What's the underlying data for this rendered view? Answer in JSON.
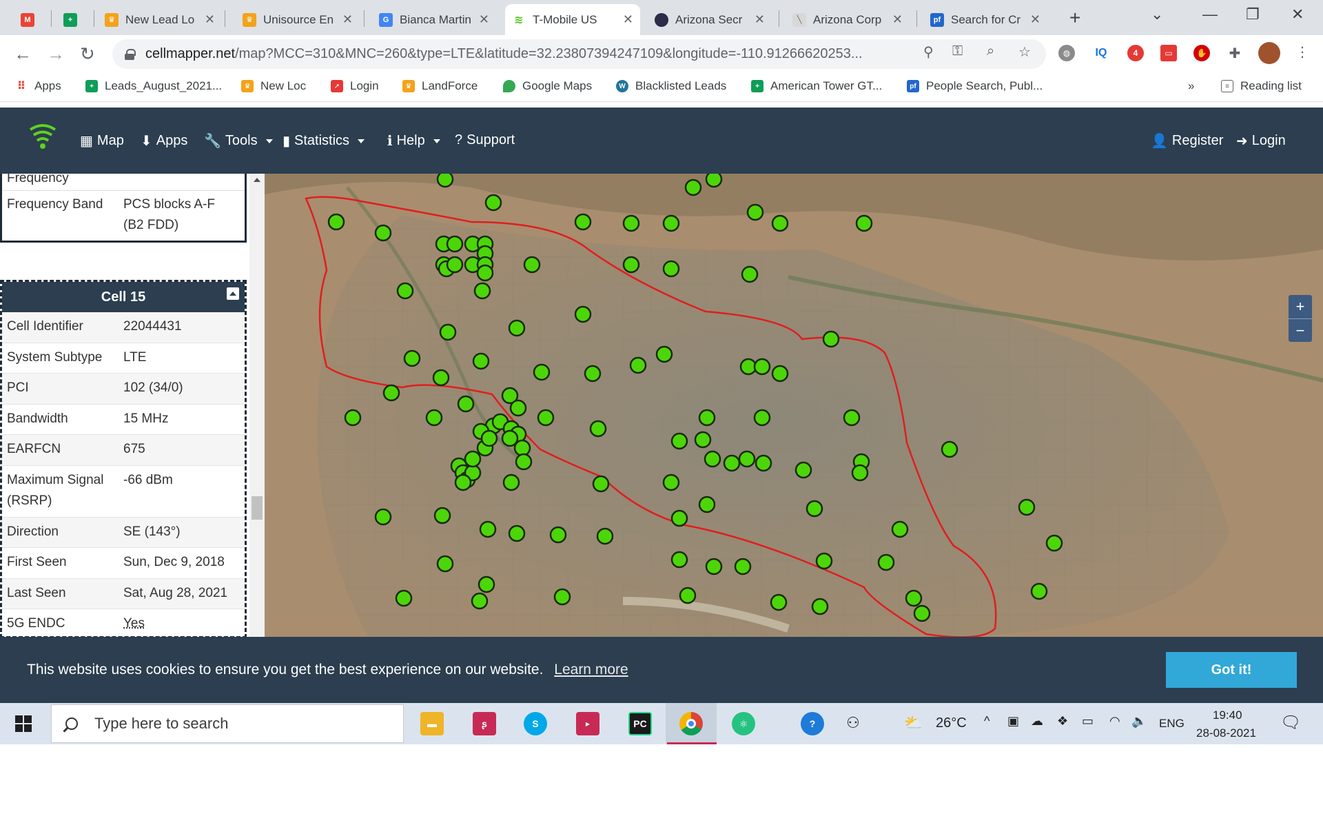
{
  "browser": {
    "tabs": [
      {
        "title": "",
        "icon": "gmail-icon"
      },
      {
        "title": "",
        "icon": "sheets-icon"
      },
      {
        "title": "New Lead Lo",
        "icon": "crown-icon"
      },
      {
        "title": "Unisource En",
        "icon": "crown-icon"
      },
      {
        "title": "Bianca Martin",
        "icon": "google-icon"
      },
      {
        "title": "T-Mobile US",
        "icon": "cellmapper-icon"
      },
      {
        "title": "Arizona Secr",
        "icon": "az-seal-icon"
      },
      {
        "title": "Arizona Corp",
        "icon": "doc-icon"
      },
      {
        "title": "Search for Cr",
        "icon": "pf-icon"
      }
    ],
    "url_host": "cellmapper.net",
    "url_path": "/map?MCC=310&MNC=260&type=LTE&latitude=32.23807394247109&longitude=-110.91266620253...",
    "extension_badge": "4",
    "bookmarks": [
      {
        "label": "Apps"
      },
      {
        "label": "Leads_August_2021..."
      },
      {
        "label": "New Loc"
      },
      {
        "label": "Login"
      },
      {
        "label": "LandForce"
      },
      {
        "label": "Google Maps"
      },
      {
        "label": "Blacklisted Leads"
      },
      {
        "label": "American Tower GT..."
      },
      {
        "label": "People Search, Publ..."
      }
    ],
    "bookmarks_more": "»",
    "reading_list": "Reading list"
  },
  "site_nav": {
    "items": [
      {
        "label": "Map"
      },
      {
        "label": "Apps"
      },
      {
        "label": "Tools"
      },
      {
        "label": "Statistics"
      },
      {
        "label": "Help"
      },
      {
        "label": "Support"
      }
    ],
    "register": "Register",
    "login": "Login"
  },
  "top_card": {
    "partial_label": "Frequency",
    "band_label": "Frequency Band",
    "band_value_1": "PCS blocks A-F",
    "band_value_2": "(B2 FDD)"
  },
  "cell_card": {
    "title": "Cell 15",
    "rows": [
      {
        "k": "Cell Identifier",
        "v": "22044431"
      },
      {
        "k": "System Subtype",
        "v": "LTE"
      },
      {
        "k": "PCI",
        "v": "102 (34/0)"
      },
      {
        "k": "Bandwidth",
        "v": "15 MHz"
      },
      {
        "k": "EARFCN",
        "v": "675"
      },
      {
        "k": "Maximum Signal",
        "k2": "(RSRP)",
        "v": "-66 dBm"
      },
      {
        "k": "Direction",
        "v": "SE (143°)"
      },
      {
        "k": "First Seen",
        "v": "Sun, Dec 9, 2018"
      },
      {
        "k": "Last Seen",
        "v": "Sat, Aug 28, 2021"
      },
      {
        "k": "5G ENDC",
        "v": "Yes"
      }
    ]
  },
  "map": {
    "zoom_in": "+",
    "zoom_out": "−",
    "tower_color": "#4cd60a",
    "boundary_color": "#e01e1e"
  },
  "cookie": {
    "message": "This website uses cookies to ensure you get the best experience on our website.",
    "link": "Learn more",
    "button": "Got it!"
  },
  "taskbar": {
    "search_placeholder": "Type here to search",
    "weather": "26°C",
    "language": "ENG",
    "time": "19:40",
    "date": "28-08-2021"
  }
}
